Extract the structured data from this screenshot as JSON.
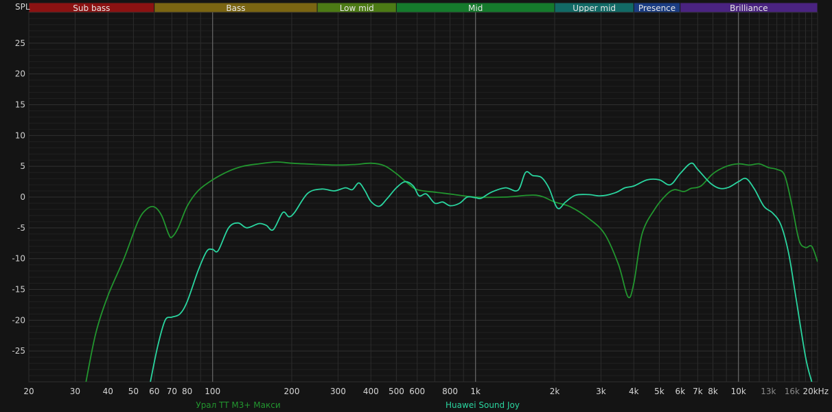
{
  "chart_data": {
    "type": "line",
    "xscale": "log",
    "xlim": [
      20,
      20000
    ],
    "ylim": [
      -30,
      30
    ],
    "ylabel": "SPL",
    "grid": true,
    "y_ticks": [
      25,
      20,
      15,
      10,
      5,
      0,
      -5,
      -10,
      -15,
      -20,
      -25
    ],
    "x_ticks": [
      {
        "v": 20,
        "label": "20",
        "dim": false
      },
      {
        "v": 30,
        "label": "30",
        "dim": false
      },
      {
        "v": 40,
        "label": "40",
        "dim": false
      },
      {
        "v": 50,
        "label": "50",
        "dim": false
      },
      {
        "v": 60,
        "label": "60",
        "dim": false
      },
      {
        "v": 70,
        "label": "70",
        "dim": false
      },
      {
        "v": 80,
        "label": "80",
        "dim": false
      },
      {
        "v": 100,
        "label": "100",
        "dim": false
      },
      {
        "v": 200,
        "label": "200",
        "dim": false
      },
      {
        "v": 300,
        "label": "300",
        "dim": false
      },
      {
        "v": 400,
        "label": "400",
        "dim": false
      },
      {
        "v": 500,
        "label": "500",
        "dim": false
      },
      {
        "v": 600,
        "label": "600",
        "dim": false
      },
      {
        "v": 800,
        "label": "800",
        "dim": false
      },
      {
        "v": 1000,
        "label": "1k",
        "dim": false
      },
      {
        "v": 2000,
        "label": "2k",
        "dim": false
      },
      {
        "v": 3000,
        "label": "3k",
        "dim": false
      },
      {
        "v": 4000,
        "label": "4k",
        "dim": false
      },
      {
        "v": 5000,
        "label": "5k",
        "dim": false
      },
      {
        "v": 6000,
        "label": "6k",
        "dim": false
      },
      {
        "v": 7000,
        "label": "7k",
        "dim": false
      },
      {
        "v": 8000,
        "label": "8k",
        "dim": false
      },
      {
        "v": 10000,
        "label": "10k",
        "dim": false
      },
      {
        "v": 13000,
        "label": "13k",
        "dim": true
      },
      {
        "v": 16000,
        "label": "16k",
        "dim": true
      },
      {
        "v": 20000,
        "label": "20kHz",
        "dim": false
      }
    ],
    "bands": [
      {
        "name": "Sub bass",
        "from": 20,
        "to": 60,
        "color": "#8b1212"
      },
      {
        "name": "Bass",
        "from": 60,
        "to": 250,
        "color": "#7a6512"
      },
      {
        "name": "Low mid",
        "from": 250,
        "to": 500,
        "color": "#4c7a15"
      },
      {
        "name": "Mid",
        "from": 500,
        "to": 2000,
        "color": "#157a2c"
      },
      {
        "name": "Upper mid",
        "from": 2000,
        "to": 4000,
        "color": "#126a66"
      },
      {
        "name": "Presence",
        "from": 4000,
        "to": 6000,
        "color": "#1a3c82"
      },
      {
        "name": "Brilliance",
        "from": 6000,
        "to": 20000,
        "color": "#4a2381"
      }
    ],
    "series": [
      {
        "name": "Урал TT M3+ Макси",
        "color": "#22962f",
        "points": [
          [
            33,
            -30
          ],
          [
            36,
            -22
          ],
          [
            40,
            -16
          ],
          [
            46,
            -10
          ],
          [
            52,
            -4
          ],
          [
            56,
            -2
          ],
          [
            60,
            -1.6
          ],
          [
            64,
            -3
          ],
          [
            68,
            -6
          ],
          [
            70,
            -6.5
          ],
          [
            74,
            -5
          ],
          [
            80,
            -1.5
          ],
          [
            88,
            1
          ],
          [
            100,
            2.8
          ],
          [
            115,
            4.2
          ],
          [
            130,
            5
          ],
          [
            150,
            5.4
          ],
          [
            175,
            5.7
          ],
          [
            200,
            5.5
          ],
          [
            250,
            5.3
          ],
          [
            300,
            5.2
          ],
          [
            350,
            5.3
          ],
          [
            400,
            5.5
          ],
          [
            450,
            5.1
          ],
          [
            500,
            3.8
          ],
          [
            550,
            2.3
          ],
          [
            600,
            1.2
          ],
          [
            700,
            0.8
          ],
          [
            800,
            0.5
          ],
          [
            1000,
            0
          ],
          [
            1300,
            0
          ],
          [
            1700,
            0.3
          ],
          [
            2000,
            -0.8
          ],
          [
            2300,
            -1.6
          ],
          [
            2700,
            -3.5
          ],
          [
            3100,
            -6
          ],
          [
            3500,
            -11
          ],
          [
            3800,
            -16.2
          ],
          [
            4000,
            -14
          ],
          [
            4300,
            -6
          ],
          [
            4800,
            -2
          ],
          [
            5300,
            0.3
          ],
          [
            5700,
            1.2
          ],
          [
            6200,
            0.9
          ],
          [
            6600,
            1.4
          ],
          [
            7200,
            1.8
          ],
          [
            8000,
            3.8
          ],
          [
            9000,
            5
          ],
          [
            10000,
            5.4
          ],
          [
            11000,
            5.2
          ],
          [
            12000,
            5.4
          ],
          [
            13000,
            4.8
          ],
          [
            14000,
            4.5
          ],
          [
            15000,
            3.5
          ],
          [
            16000,
            -1.5
          ],
          [
            17000,
            -7
          ],
          [
            18000,
            -8.2
          ],
          [
            19000,
            -8
          ],
          [
            20000,
            -10.5
          ]
        ]
      },
      {
        "name": "Huawei Sound Joy",
        "color": "#2ad6a0",
        "points": [
          [
            58,
            -30
          ],
          [
            62,
            -24
          ],
          [
            66,
            -20
          ],
          [
            70,
            -19.5
          ],
          [
            75,
            -19
          ],
          [
            80,
            -17
          ],
          [
            88,
            -12
          ],
          [
            95,
            -8.8
          ],
          [
            100,
            -8.5
          ],
          [
            105,
            -8.7
          ],
          [
            115,
            -5
          ],
          [
            125,
            -4.2
          ],
          [
            135,
            -5
          ],
          [
            150,
            -4.3
          ],
          [
            160,
            -4.6
          ],
          [
            170,
            -5.3
          ],
          [
            185,
            -2.5
          ],
          [
            195,
            -3.2
          ],
          [
            205,
            -2.5
          ],
          [
            230,
            0.6
          ],
          [
            260,
            1.3
          ],
          [
            290,
            1
          ],
          [
            320,
            1.5
          ],
          [
            340,
            1.2
          ],
          [
            360,
            2.3
          ],
          [
            380,
            1
          ],
          [
            400,
            -0.7
          ],
          [
            430,
            -1.5
          ],
          [
            460,
            -0.3
          ],
          [
            500,
            1.5
          ],
          [
            540,
            2.5
          ],
          [
            580,
            1.8
          ],
          [
            610,
            0.2
          ],
          [
            650,
            0.5
          ],
          [
            700,
            -1
          ],
          [
            750,
            -0.8
          ],
          [
            800,
            -1.4
          ],
          [
            870,
            -1
          ],
          [
            930,
            0
          ],
          [
            1000,
            -0.1
          ],
          [
            1050,
            -0.2
          ],
          [
            1150,
            0.8
          ],
          [
            1300,
            1.5
          ],
          [
            1450,
            1.1
          ],
          [
            1550,
            4
          ],
          [
            1650,
            3.5
          ],
          [
            1780,
            3.2
          ],
          [
            1900,
            1.5
          ],
          [
            2050,
            -1.8
          ],
          [
            2200,
            -0.8
          ],
          [
            2400,
            0.3
          ],
          [
            2700,
            0.4
          ],
          [
            3000,
            0.2
          ],
          [
            3400,
            0.7
          ],
          [
            3700,
            1.5
          ],
          [
            4000,
            1.8
          ],
          [
            4500,
            2.8
          ],
          [
            5000,
            2.8
          ],
          [
            5500,
            2
          ],
          [
            6000,
            3.8
          ],
          [
            6600,
            5.5
          ],
          [
            7000,
            4.5
          ],
          [
            7800,
            2.3
          ],
          [
            8500,
            1.4
          ],
          [
            9200,
            1.6
          ],
          [
            10000,
            2.5
          ],
          [
            10700,
            3
          ],
          [
            11500,
            1.3
          ],
          [
            12500,
            -1.5
          ],
          [
            13500,
            -2.6
          ],
          [
            14500,
            -4.5
          ],
          [
            15500,
            -9
          ],
          [
            16500,
            -16
          ],
          [
            18000,
            -26
          ],
          [
            19000,
            -30
          ]
        ]
      }
    ]
  }
}
